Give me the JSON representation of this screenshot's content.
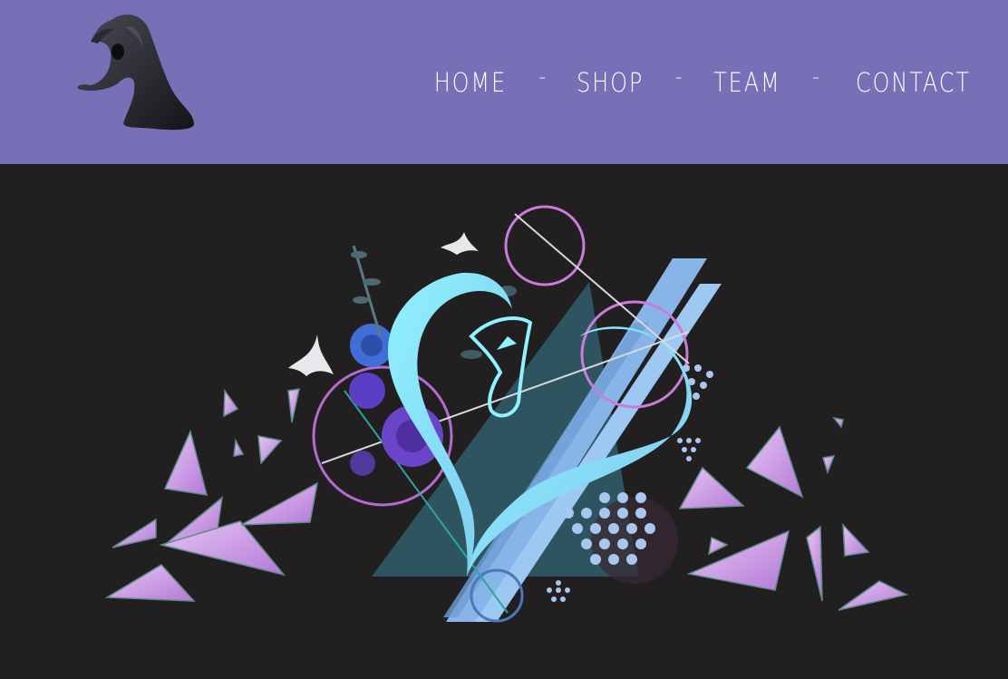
{
  "header": {
    "background": "#7670b6",
    "logo": {
      "icon": "abstract-horse-head-sculpture-icon"
    }
  },
  "nav": {
    "items": [
      {
        "label": "HOME"
      },
      {
        "label": "SHOP"
      },
      {
        "label": "TEAM"
      },
      {
        "label": "CONTACT"
      }
    ],
    "separator": "-"
  },
  "hero": {
    "background": "#211f20",
    "artwork": {
      "icon": "heart-horse-geometric-artwork",
      "colors": {
        "heart": "#84e6f5",
        "stripes": "#8fc3f0",
        "shards": "#c48fe0",
        "rings": "#c97dd9",
        "flowers": "#6b45c9"
      }
    }
  }
}
